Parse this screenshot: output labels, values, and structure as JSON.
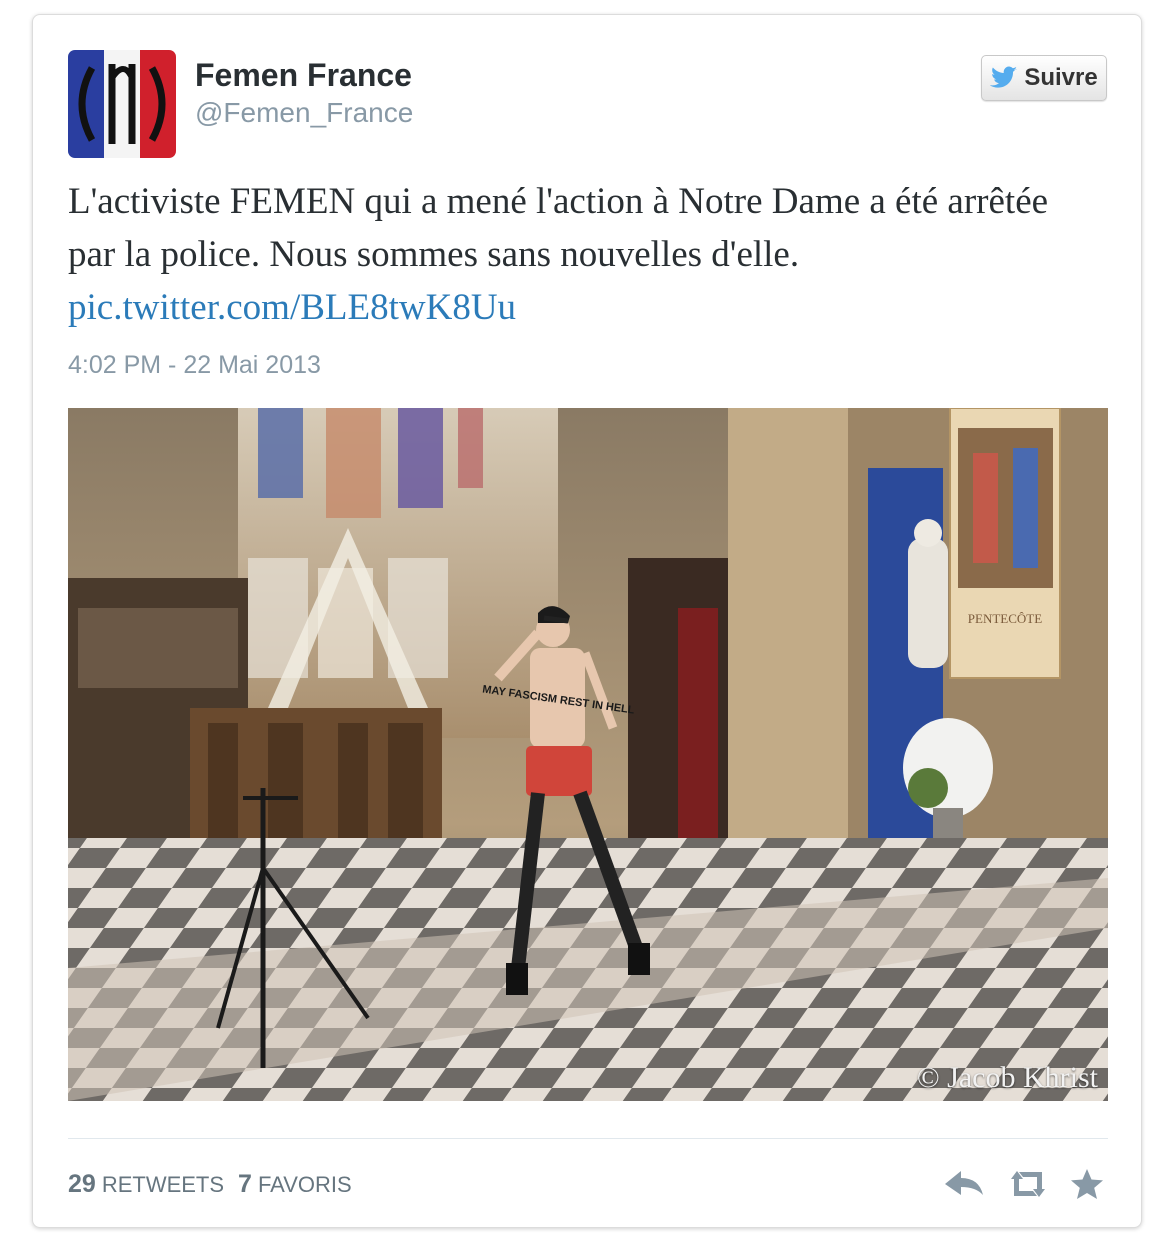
{
  "author": {
    "name": "Femen France",
    "handle": "@Femen_France"
  },
  "follow_button": {
    "label": "Suivre",
    "icon": "twitter-bird-icon"
  },
  "tweet": {
    "text": "L'activiste FEMEN qui a mené l'action à Notre Dame a été arrêtée par la police. Nous sommes sans nouvelles d'elle.",
    "link": "pic.twitter.com/BLE8twK8Uu",
    "timestamp": "4:02 PM - 22 Mai 2013"
  },
  "photo": {
    "credit": "© Jacob Khrist",
    "body_text": "MAY FASCISM REST IN HELL",
    "banner_text": "PENTECÔTE"
  },
  "stats": {
    "retweets_count": "29",
    "retweets_label": "RETWEETS",
    "favorites_count": "7",
    "favorites_label": "FAVORIS"
  },
  "actions": {
    "reply_icon": "reply-icon",
    "retweet_icon": "retweet-icon",
    "favorite_icon": "star-icon"
  },
  "colors": {
    "link": "#2b7bb9",
    "meta": "#8899a6",
    "text": "#292f33",
    "twitter_blue": "#55acee"
  }
}
